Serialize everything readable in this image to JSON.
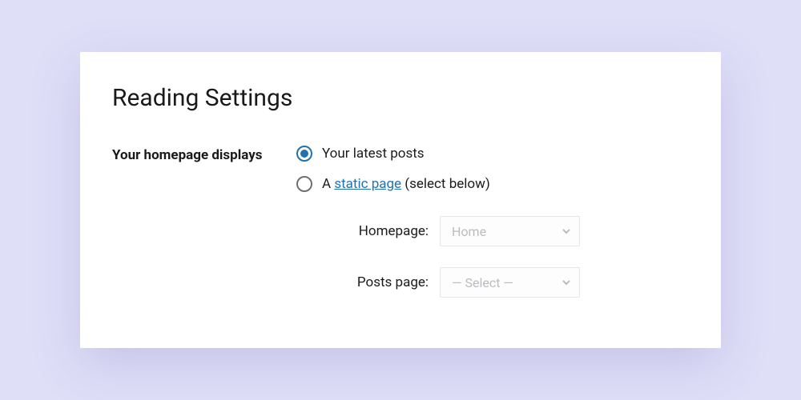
{
  "title": "Reading Settings",
  "section_label": "Your homepage displays",
  "options": {
    "latest": "Your latest posts",
    "static_prefix": "A ",
    "static_link": "static page",
    "static_suffix": " (select below)"
  },
  "selects": {
    "homepage_label": "Homepage:",
    "homepage_value": "Home",
    "postspage_label": "Posts page:",
    "postspage_value": "— Select —"
  }
}
